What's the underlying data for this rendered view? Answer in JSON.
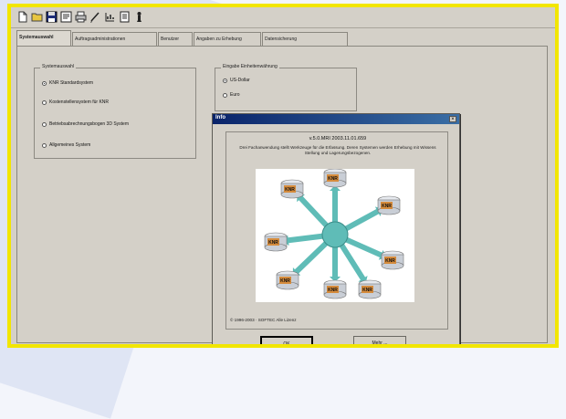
{
  "toolbar": {
    "icons": [
      "new-file-icon",
      "open-folder-icon",
      "save-icon",
      "print-preview-icon",
      "print-icon",
      "draw-icon",
      "list-icon",
      "document-icon",
      "info-icon"
    ]
  },
  "tabs": [
    {
      "label": "Systemauswahl",
      "active": true
    },
    {
      "label": "Auftragsadministrationen",
      "active": false
    },
    {
      "label": "Benutzer",
      "active": false
    },
    {
      "label": "Angaben zu Erhebung",
      "active": false
    },
    {
      "label": "Datensicherung",
      "active": false
    }
  ],
  "left_group": {
    "title": "Systemauswahl",
    "options": [
      {
        "label": "KNR Standardsystem",
        "selected": true
      },
      {
        "label": "Kostenstellensystem für KNR",
        "selected": false
      },
      {
        "label": "Betriebsabrechnungsbogen 3D System",
        "selected": false
      },
      {
        "label": "Allgemeines System",
        "selected": false
      }
    ]
  },
  "right_group": {
    "title": "Eingabe Einheitenwährung",
    "options": [
      {
        "label": "US-Dollar",
        "selected": true
      },
      {
        "label": "Euro",
        "selected": false
      }
    ]
  },
  "dialog": {
    "title": "Info",
    "close_label": "×",
    "version": "v.5.0.MRI 2003.11.01.659",
    "description": "Drei Fachanwendung stellt Werkzeuge für die Erfassung. Deren Systemen werden Erhebung mit Wissens Stellung und Lagerungsbezogenen.",
    "diagram_labels": [
      "KNR",
      "KNR",
      "KNR",
      "KNR",
      "KNR",
      "KNR",
      "KNR",
      "KNR"
    ],
    "copyright": "© 1996-2003 · SOFTEC Alle Lizenz",
    "ok_label": "OK",
    "more_label": "Mehr ..."
  },
  "colors": {
    "highlight_border": "#f2e600",
    "title_bar_start": "#0a246a",
    "title_bar_end": "#3a6ea5",
    "hub": "#5fbcb7",
    "node_body": "#c9ced6",
    "node_label_bg": "#d58b3c"
  }
}
